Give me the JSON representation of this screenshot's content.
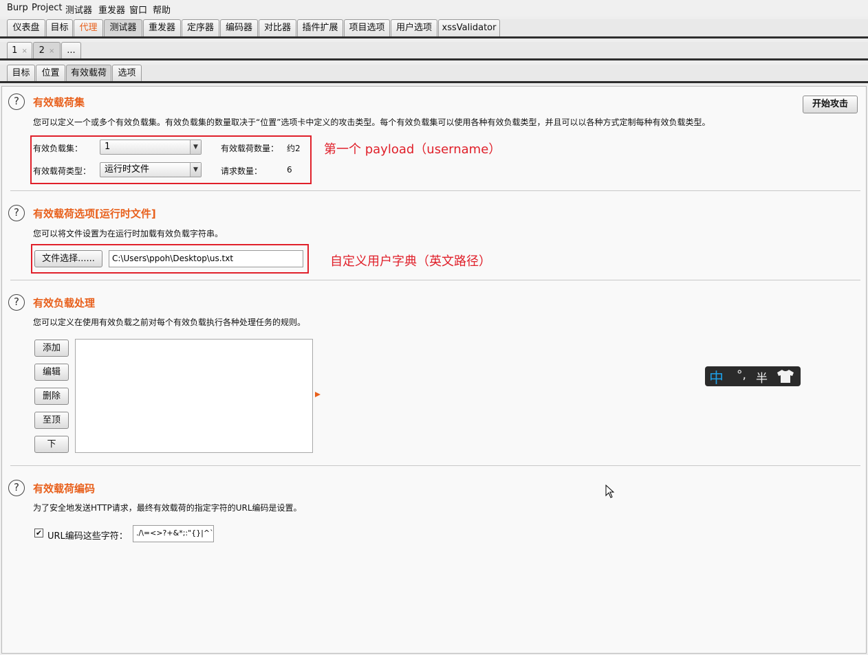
{
  "menubar": {
    "items": [
      "Burp",
      "Project",
      "测试器",
      "重发器",
      "窗口",
      "帮助"
    ]
  },
  "main_tabs": [
    {
      "label": "仪表盘"
    },
    {
      "label": "目标"
    },
    {
      "label": "代理"
    },
    {
      "label": "测试器"
    },
    {
      "label": "重发器"
    },
    {
      "label": "定序器"
    },
    {
      "label": "编码器"
    },
    {
      "label": "对比器"
    },
    {
      "label": "插件扩展"
    },
    {
      "label": "项目选项"
    },
    {
      "label": "用户选项"
    },
    {
      "label": "xssValidator"
    }
  ],
  "attack_tabs": [
    {
      "label": "1",
      "close": "×"
    },
    {
      "label": "2",
      "close": "×"
    },
    {
      "label": "..."
    }
  ],
  "sub_tabs": [
    {
      "label": "目标"
    },
    {
      "label": "位置"
    },
    {
      "label": "有效载荷"
    },
    {
      "label": "选项"
    }
  ],
  "help_glyph": "?",
  "start_attack": "开始攻击",
  "payload_sets": {
    "title": "有效载荷集",
    "description": "您可以定义一个或多个有效负载集。有效负载集的数量取决于“位置”选项卡中定义的攻击类型。每个有效负载集可以使用各种有效负载类型，并且可以以各种方式定制每种有效负载类型。",
    "set_label": "有效负载集：",
    "set_value": "1",
    "type_label": "有效载荷类型：",
    "type_value": "运行时文件",
    "count_label": "有效载荷数量：",
    "count_value": "约2",
    "requests_label": "请求数量：",
    "requests_value": "6",
    "annotation": "第一个 payload（username）"
  },
  "payload_options": {
    "title": "有效载荷选项[运行时文件]",
    "description": "您可以将文件设置为在运行时加载有效负载字符串。",
    "file_button": "文件选择......",
    "file_path": "C:\\Users\\ppoh\\Desktop\\us.txt",
    "annotation": "自定义用户字典（英文路径）"
  },
  "payload_processing": {
    "title": "有效负载处理",
    "description": "您可以定义在使用有效负载之前对每个有效负载执行各种处理任务的规则。",
    "buttons": [
      "添加",
      "编辑",
      "删除",
      "至顶",
      "下"
    ]
  },
  "payload_encoding": {
    "title": "有效载荷编码",
    "description": "为了安全地发送HTTP请求，最终有效载荷的指定字符的URL编码是设置。",
    "checkbox_label": "URL编码这些字符：",
    "checked": true,
    "chars": "./\\=<>?+&*;:\"{}|^`"
  },
  "ime": {
    "mode": "中",
    "punct": "°,",
    "width": "半",
    "skin_icon": "shirt-icon"
  },
  "colors": {
    "accent": "#e8601c",
    "annotation": "#e0202a"
  }
}
